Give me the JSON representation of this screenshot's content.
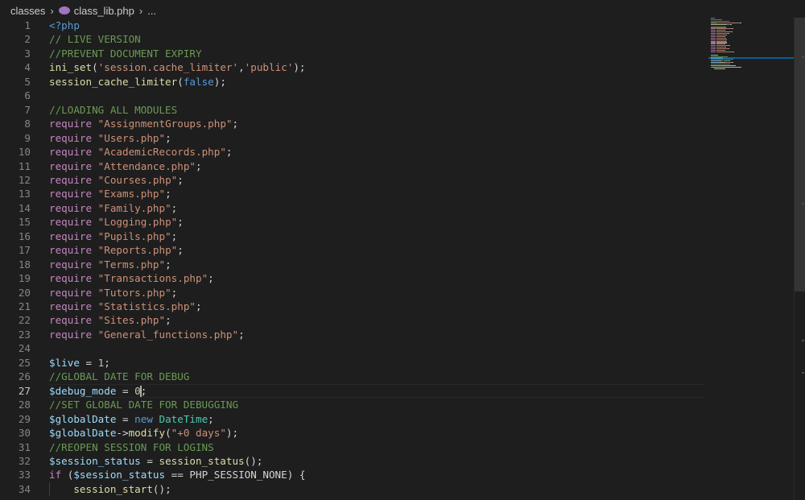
{
  "breadcrumb": {
    "folder": "classes",
    "file": "class_lib.php",
    "more": "..."
  },
  "icons": {
    "separator": "chevron-right-icon",
    "file": "php-elephant-icon"
  },
  "editor": {
    "active_line": 27,
    "lines": [
      {
        "n": "1",
        "tokens": [
          {
            "t": "<?php",
            "c": "b"
          }
        ]
      },
      {
        "n": "2",
        "tokens": [
          {
            "t": "// LIVE VERSION",
            "c": "c"
          }
        ]
      },
      {
        "n": "3",
        "tokens": [
          {
            "t": "//PREVENT DOCUMENT EXPIRY",
            "c": "c"
          }
        ]
      },
      {
        "n": "4",
        "tokens": [
          {
            "t": "ini_set",
            "c": "f"
          },
          {
            "t": "(",
            "c": ""
          },
          {
            "t": "'session.cache_limiter'",
            "c": "s"
          },
          {
            "t": ",",
            "c": ""
          },
          {
            "t": "'public'",
            "c": "s"
          },
          {
            "t": ");",
            "c": ""
          }
        ]
      },
      {
        "n": "5",
        "tokens": [
          {
            "t": "session_cache_limiter",
            "c": "f"
          },
          {
            "t": "(",
            "c": ""
          },
          {
            "t": "false",
            "c": "b"
          },
          {
            "t": ");",
            "c": ""
          }
        ]
      },
      {
        "n": "6",
        "tokens": []
      },
      {
        "n": "7",
        "tokens": [
          {
            "t": "//LOADING ALL MODULES",
            "c": "c"
          }
        ]
      },
      {
        "n": "8",
        "tokens": [
          {
            "t": "require",
            "c": "k"
          },
          {
            "t": " ",
            "c": ""
          },
          {
            "t": "\"AssignmentGroups.php\"",
            "c": "s"
          },
          {
            "t": ";",
            "c": ""
          }
        ]
      },
      {
        "n": "9",
        "tokens": [
          {
            "t": "require",
            "c": "k"
          },
          {
            "t": " ",
            "c": ""
          },
          {
            "t": "\"Users.php\"",
            "c": "s"
          },
          {
            "t": ";",
            "c": ""
          }
        ]
      },
      {
        "n": "10",
        "tokens": [
          {
            "t": "require",
            "c": "k"
          },
          {
            "t": " ",
            "c": ""
          },
          {
            "t": "\"AcademicRecords.php\"",
            "c": "s"
          },
          {
            "t": ";",
            "c": ""
          }
        ]
      },
      {
        "n": "11",
        "tokens": [
          {
            "t": "require",
            "c": "k"
          },
          {
            "t": " ",
            "c": ""
          },
          {
            "t": "\"Attendance.php\"",
            "c": "s"
          },
          {
            "t": ";",
            "c": ""
          }
        ]
      },
      {
        "n": "12",
        "tokens": [
          {
            "t": "require",
            "c": "k"
          },
          {
            "t": " ",
            "c": ""
          },
          {
            "t": "\"Courses.php\"",
            "c": "s"
          },
          {
            "t": ";",
            "c": ""
          }
        ]
      },
      {
        "n": "13",
        "tokens": [
          {
            "t": "require",
            "c": "k"
          },
          {
            "t": " ",
            "c": ""
          },
          {
            "t": "\"Exams.php\"",
            "c": "s"
          },
          {
            "t": ";",
            "c": ""
          }
        ]
      },
      {
        "n": "14",
        "tokens": [
          {
            "t": "require",
            "c": "k"
          },
          {
            "t": " ",
            "c": ""
          },
          {
            "t": "\"Family.php\"",
            "c": "s"
          },
          {
            "t": ";",
            "c": ""
          }
        ]
      },
      {
        "n": "15",
        "tokens": [
          {
            "t": "require",
            "c": "k"
          },
          {
            "t": " ",
            "c": ""
          },
          {
            "t": "\"Logging.php\"",
            "c": "s"
          },
          {
            "t": ";",
            "c": ""
          }
        ]
      },
      {
        "n": "16",
        "tokens": [
          {
            "t": "require",
            "c": "k"
          },
          {
            "t": " ",
            "c": ""
          },
          {
            "t": "\"Pupils.php\"",
            "c": "s"
          },
          {
            "t": ";",
            "c": ""
          }
        ]
      },
      {
        "n": "17",
        "tokens": [
          {
            "t": "require",
            "c": "k"
          },
          {
            "t": " ",
            "c": ""
          },
          {
            "t": "\"Reports.php\"",
            "c": "s"
          },
          {
            "t": ";",
            "c": ""
          }
        ]
      },
      {
        "n": "18",
        "tokens": [
          {
            "t": "require",
            "c": "k"
          },
          {
            "t": " ",
            "c": ""
          },
          {
            "t": "\"Terms.php\"",
            "c": "s"
          },
          {
            "t": ";",
            "c": ""
          }
        ]
      },
      {
        "n": "19",
        "tokens": [
          {
            "t": "require",
            "c": "k"
          },
          {
            "t": " ",
            "c": ""
          },
          {
            "t": "\"Transactions.php\"",
            "c": "s"
          },
          {
            "t": ";",
            "c": ""
          }
        ]
      },
      {
        "n": "20",
        "tokens": [
          {
            "t": "require",
            "c": "k"
          },
          {
            "t": " ",
            "c": ""
          },
          {
            "t": "\"Tutors.php\"",
            "c": "s"
          },
          {
            "t": ";",
            "c": ""
          }
        ]
      },
      {
        "n": "21",
        "tokens": [
          {
            "t": "require",
            "c": "k"
          },
          {
            "t": " ",
            "c": ""
          },
          {
            "t": "\"Statistics.php\"",
            "c": "s"
          },
          {
            "t": ";",
            "c": ""
          }
        ]
      },
      {
        "n": "22",
        "tokens": [
          {
            "t": "require",
            "c": "k"
          },
          {
            "t": " ",
            "c": ""
          },
          {
            "t": "\"Sites.php\"",
            "c": "s"
          },
          {
            "t": ";",
            "c": ""
          }
        ]
      },
      {
        "n": "23",
        "tokens": [
          {
            "t": "require",
            "c": "k"
          },
          {
            "t": " ",
            "c": ""
          },
          {
            "t": "\"General_functions.php\"",
            "c": "s"
          },
          {
            "t": ";",
            "c": ""
          }
        ]
      },
      {
        "n": "24",
        "tokens": []
      },
      {
        "n": "25",
        "tokens": [
          {
            "t": "$live",
            "c": "v"
          },
          {
            "t": " = ",
            "c": ""
          },
          {
            "t": "1",
            "c": "n"
          },
          {
            "t": ";",
            "c": ""
          }
        ]
      },
      {
        "n": "26",
        "tokens": [
          {
            "t": "//GLOBAL DATE FOR DEBUG",
            "c": "c"
          }
        ]
      },
      {
        "n": "27",
        "tokens": [
          {
            "t": "$debug_mode",
            "c": "v"
          },
          {
            "t": " = ",
            "c": ""
          },
          {
            "t": "0",
            "c": "n"
          },
          {
            "t": "|",
            "c": "cursor"
          },
          {
            "t": ";",
            "c": ""
          }
        ]
      },
      {
        "n": "28",
        "tokens": [
          {
            "t": "//SET GLOBAL DATE FOR DEBUGGING",
            "c": "c"
          }
        ]
      },
      {
        "n": "29",
        "tokens": [
          {
            "t": "$globalDate",
            "c": "v"
          },
          {
            "t": " = ",
            "c": ""
          },
          {
            "t": "new",
            "c": "b"
          },
          {
            "t": " ",
            "c": ""
          },
          {
            "t": "DateTime",
            "c": "t"
          },
          {
            "t": ";",
            "c": ""
          }
        ]
      },
      {
        "n": "30",
        "tokens": [
          {
            "t": "$globalDate",
            "c": "v"
          },
          {
            "t": "->",
            "c": ""
          },
          {
            "t": "modify",
            "c": "f"
          },
          {
            "t": "(",
            "c": ""
          },
          {
            "t": "\"+0 days\"",
            "c": "s"
          },
          {
            "t": ");",
            "c": ""
          }
        ]
      },
      {
        "n": "31",
        "tokens": [
          {
            "t": "//REOPEN SESSION FOR LOGINS",
            "c": "c"
          }
        ]
      },
      {
        "n": "32",
        "tokens": [
          {
            "t": "$session_status",
            "c": "v"
          },
          {
            "t": " = ",
            "c": ""
          },
          {
            "t": "session_status",
            "c": "f"
          },
          {
            "t": "();",
            "c": ""
          }
        ]
      },
      {
        "n": "33",
        "tokens": [
          {
            "t": "if",
            "c": "k"
          },
          {
            "t": " (",
            "c": ""
          },
          {
            "t": "$session_status",
            "c": "v"
          },
          {
            "t": " == PHP_SESSION_NONE) {",
            "c": ""
          }
        ]
      },
      {
        "n": "34",
        "tokens": [
          {
            "t": "    ",
            "c": "indent"
          },
          {
            "t": "session_start",
            "c": "f"
          },
          {
            "t": "();",
            "c": ""
          }
        ]
      }
    ]
  },
  "colors": {
    "background": "#1e1e1e",
    "keyword": "#c586c0",
    "string": "#ce9178",
    "comment": "#6a9955",
    "variable": "#9cdcfe",
    "function": "#dcdcaa",
    "constant": "#569cd6",
    "number": "#b5cea8",
    "class": "#4ec9b0",
    "minimap_highlight": "#007acc"
  }
}
